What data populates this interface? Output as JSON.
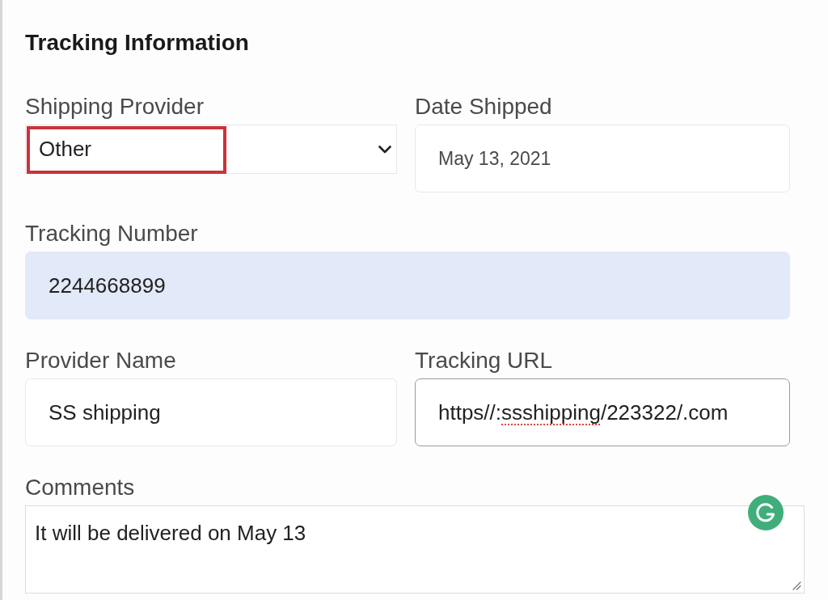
{
  "section": {
    "title": "Tracking Information"
  },
  "rows": [
    [
      {
        "kind": "select",
        "label": "Shipping Provider",
        "value": "Other",
        "highlighted": true,
        "focused": false,
        "autofilled": false
      },
      {
        "kind": "date",
        "label": "Date Shipped",
        "value": "May 13, 2021",
        "highlighted": false,
        "focused": false,
        "autofilled": false
      }
    ],
    [
      {
        "kind": "input",
        "label": "Tracking Number",
        "value": "2244668899",
        "highlighted": false,
        "focused": false,
        "autofilled": true
      }
    ],
    [
      {
        "kind": "input",
        "label": "Provider Name",
        "value": "SS shipping",
        "highlighted": false,
        "focused": false,
        "autofilled": false
      },
      {
        "kind": "input",
        "label": "Tracking URL",
        "value_parts": [
          {
            "text": "https//:",
            "misspelled": false
          },
          {
            "text": "ssshipping",
            "misspelled": true
          },
          {
            "text": "/223322/.com",
            "misspelled": false
          }
        ],
        "highlighted": false,
        "focused": true,
        "autofilled": false
      }
    ],
    [
      {
        "kind": "textarea",
        "label": "Comments",
        "value": "It will be delivered on May 13",
        "highlighted": false,
        "focused": false,
        "autofilled": false
      }
    ]
  ]
}
